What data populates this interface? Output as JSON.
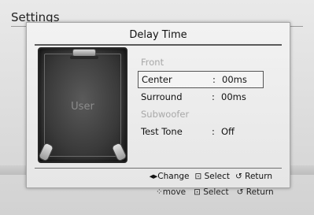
{
  "page": {
    "title": "Settings"
  },
  "dialog": {
    "title": "Delay Time",
    "diagram_label": "User",
    "items": [
      {
        "label": "Front",
        "value": "",
        "enabled": false,
        "selected": false
      },
      {
        "label": "Center",
        "value": "00ms",
        "enabled": true,
        "selected": true
      },
      {
        "label": "Surround",
        "value": "00ms",
        "enabled": true,
        "selected": false
      },
      {
        "label": "Subwoofer",
        "value": "",
        "enabled": false,
        "selected": false
      },
      {
        "label": "Test Tone",
        "value": "Off",
        "enabled": true,
        "selected": false
      }
    ],
    "hints": {
      "change": "◂▸Change",
      "select": "⊡ Select",
      "return": "↺ Return"
    }
  },
  "footer": {
    "move": "⁘move",
    "select": "⊡ Select",
    "return": "↺ Return"
  }
}
